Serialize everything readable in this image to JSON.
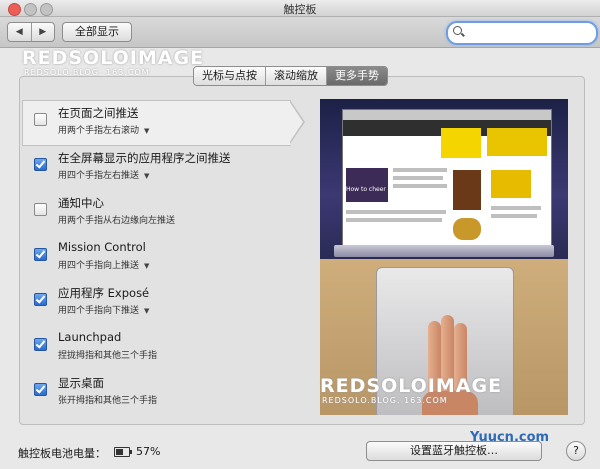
{
  "window": {
    "title": "触控板"
  },
  "toolbar": {
    "back_label": "◀",
    "forward_label": "▶",
    "show_all_label": "全部显示",
    "search_value": ""
  },
  "tabs": [
    {
      "label": "光标与点按",
      "active": false
    },
    {
      "label": "滚动缩放",
      "active": false
    },
    {
      "label": "更多手势",
      "active": true
    }
  ],
  "gestures": [
    {
      "title": "在页面之间推送",
      "subtitle": "用两个手指左右滚动",
      "checked": false,
      "selected": true
    },
    {
      "title": "在全屏幕显示的应用程序之间推送",
      "subtitle": "用四个手指左右推送",
      "checked": true
    },
    {
      "title": "通知中心",
      "subtitle": "用两个手指从右边缘向左推送",
      "checked": false
    },
    {
      "title": "Mission Control",
      "subtitle": "用四个手指向上推送",
      "checked": true
    },
    {
      "title": "应用程序 Exposé",
      "subtitle": "用四个手指向下推送",
      "checked": true
    },
    {
      "title": "Launchpad",
      "subtitle": "捏拢拇指和其他三个手指",
      "checked": true
    },
    {
      "title": "显示桌面",
      "subtitle": "张开拇指和其他三个手指",
      "checked": true
    }
  ],
  "preview": {
    "browser_text": "How to cheer up it"
  },
  "footer": {
    "battery_label": "触控板电池电量：",
    "battery_percent": "57%",
    "battery_level": 0.57,
    "bluetooth_button_label": "设置蓝牙触控板…",
    "help_label": "?"
  },
  "watermarks": {
    "brand": "REDSOLOIMAGE",
    "url": "REDSOLO.BLOG. 163.COM",
    "site": "Yuucn.com"
  },
  "colors": {
    "accent": "#2b6ad0",
    "active_tab": "#6a6a6a"
  }
}
